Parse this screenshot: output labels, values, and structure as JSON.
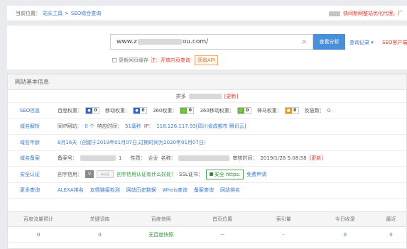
{
  "breadcrumb": {
    "prefix": "当前位置：",
    "root": "站长工具",
    "sep": ">",
    "current": "SEO综合查询"
  },
  "notice": {
    "text": "快间新网整站优化代理，厂"
  },
  "search": {
    "url_prefix": "www.z",
    "url_suffix": "ou.com/",
    "clear_icon": "×",
    "analyze_label": "查看分析",
    "history_label": "查询记录 ▾",
    "seo_client_label": "SEO客户端",
    "update_cache_label": "更新网页缓存",
    "note": "注：开放内页查询",
    "get_api_label": "获取API"
  },
  "panel": {
    "title": "网站基本信息",
    "site_title_prefix": "拼多",
    "site_title_update": "[更新]",
    "rows": {
      "seo": {
        "label": "SEO信息",
        "items": [
          {
            "name": "百度权重：",
            "icon": "baidu-icon",
            "value": "0"
          },
          {
            "name": "移动权重：",
            "icon": "baidu-mobile-icon",
            "value": "0"
          },
          {
            "name": "360权重：",
            "icon": "360-icon",
            "value": "0"
          },
          {
            "name": "360移动权重：",
            "icon": "360-mobile-icon",
            "value": "0"
          },
          {
            "name": "神马权重：",
            "icon": "shenma-icon",
            "value": "0"
          }
        ],
        "backlinks_label": "反链数：",
        "backlinks_value": "0"
      },
      "resolve": {
        "label": "域名解析",
        "same_ip_label": "同IP网站：",
        "same_ip_value": "0 个",
        "response_label": "响应时间：",
        "response_value": "51毫秒",
        "ip_label": "IP：",
        "ip_value": "118.126.117.93[四川省成都市 腾讯云]"
      },
      "age": {
        "label": "域名年龄",
        "text": "8月16天（创建于2019年01月07日,过期时间为2020年01月07日）"
      },
      "icp": {
        "label": "域名备案",
        "icp_label": "备案号：",
        "icp_suffix": "1",
        "nature_label": "性质：",
        "nature_value": "企业",
        "name_label": "名称：",
        "audit_label": "审核时间：",
        "audit_value": "2019/1/28 5:08:58",
        "update_label": "[更新]"
      },
      "security": {
        "label": "安全认证",
        "credit_label": "创宇信用：",
        "credit_badge_text": "V",
        "credit_box_text": "未认证",
        "credit_link": "创宇信用认证有什么好处？",
        "ssl_label": "SSL证书：",
        "ssl_value": "安全 https:",
        "ssl_free": "免费申请"
      },
      "more": {
        "label": "更多查询",
        "links": [
          "ALEXA排名",
          "友情链接检测",
          "网站历史数据",
          "Whois查询",
          "备案查询",
          "网站排名"
        ]
      }
    },
    "stats": {
      "headers": [
        "百度流量预计",
        "关键词库",
        "百度快照",
        "首页位置",
        "索引量",
        "今日收录",
        "最近"
      ],
      "values": [
        "0",
        "0",
        "无百度快照",
        "--",
        "-",
        "0",
        "0"
      ]
    }
  }
}
